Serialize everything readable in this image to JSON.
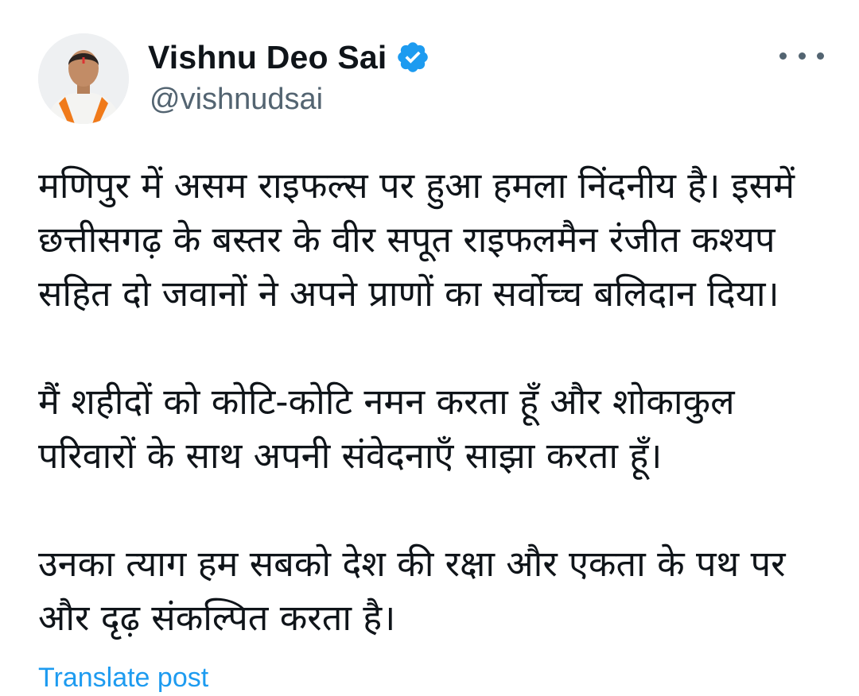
{
  "author": {
    "display_name": "Vishnu Deo Sai",
    "handle": "@vishnudsai",
    "verified": true,
    "avatar_icon": "profile-photo",
    "verified_icon": "verified-badge-icon"
  },
  "menu": {
    "icon": "more-options-icon"
  },
  "post": {
    "paragraphs": [
      {
        "lines": [
          "मणिपुर में असम राइफल्स पर हुआ हमला निंदनीय है। इसमें",
          "छत्तीसगढ़ के बस्तर के वीर सपूत राइफलमैन रंजीत कश्यप",
          "सहित दो जवानों ने अपने प्राणों का सर्वोच्च बलिदान दिया।"
        ]
      },
      {
        "lines": [
          "मैं शहीदों को कोटि-कोटि नमन करता हूँ और शोकाकुल",
          "परिवारों के साथ अपनी संवेदनाएँ साझा करता हूँ।"
        ]
      },
      {
        "lines": [
          "उनका त्याग हम सबको देश की रक्षा और एकता के पथ पर",
          "और दृढ़ संकल्पित करता है।"
        ]
      }
    ]
  },
  "actions": {
    "translate_label": "Translate post"
  },
  "colors": {
    "text": "#0f1419",
    "secondary": "#536471",
    "link": "#1d9bf0"
  }
}
